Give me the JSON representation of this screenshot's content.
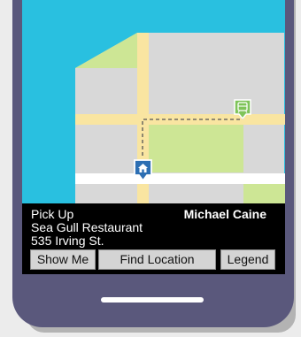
{
  "pickup": {
    "label": "Pick Up",
    "place": "Sea Gull Restaurant",
    "address": "535 Irving St."
  },
  "driver": {
    "name": "Michael Caine"
  },
  "buttons": {
    "show_me": "Show Me",
    "find_location": "Find Location",
    "legend": "Legend"
  },
  "map": {
    "icons": {
      "destination": "home-icon",
      "vehicle": "train-icon"
    },
    "colors": {
      "water": "#29c0e0",
      "land": "#d8d8d8",
      "park": "#cde695",
      "road": "#f9e5a1",
      "route": "#555555",
      "pin": "#2d6fb3",
      "vehicle": "#7fc45a"
    }
  }
}
